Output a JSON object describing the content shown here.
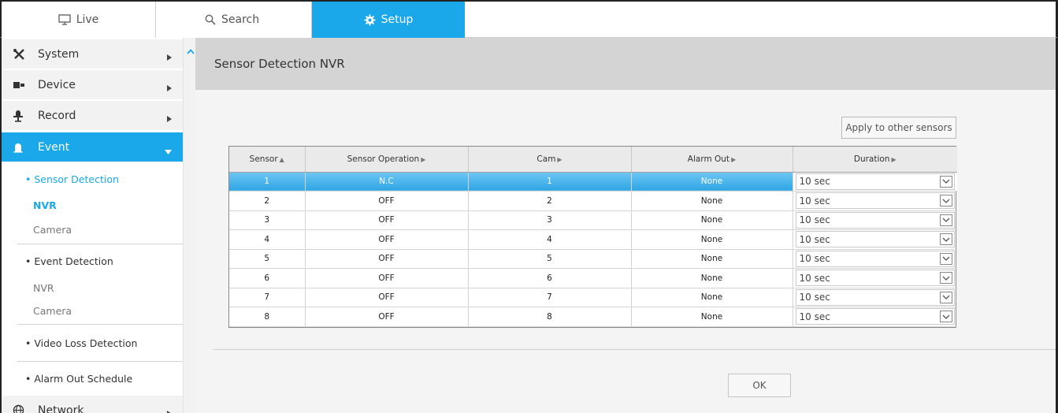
{
  "tabs": [
    {
      "label": "Live",
      "icon": "monitor-icon"
    },
    {
      "label": "Search",
      "icon": "search-icon"
    },
    {
      "label": "Setup",
      "icon": "gear-icon",
      "active": true
    }
  ],
  "sidebar": {
    "menu": [
      {
        "label": "System",
        "icon": "tools-icon"
      },
      {
        "label": "Device",
        "icon": "device-icon"
      },
      {
        "label": "Record",
        "icon": "record-icon"
      },
      {
        "label": "Event",
        "icon": "event-icon",
        "active": true
      },
      {
        "label": "Network",
        "icon": "globe-icon"
      }
    ],
    "event_sub": {
      "sensor_detection": "• Sensor Detection",
      "sensor_nvr": "NVR",
      "sensor_camera": "Camera",
      "event_detection": "• Event Detection",
      "event_nvr": "NVR",
      "event_camera": "Camera",
      "video_loss": "• Video Loss Detection",
      "alarm_out": "• Alarm Out Schedule"
    }
  },
  "main": {
    "title": "Sensor Detection NVR",
    "apply_label": "Apply to other sensors",
    "ok_label": "OK"
  },
  "table": {
    "headers": [
      "Sensor",
      "Sensor Operation",
      "Cam",
      "Alarm Out",
      "Duration"
    ],
    "rows": [
      {
        "sensor": "1",
        "operation": "N.C",
        "cam": "1",
        "alarm_out": "None",
        "duration": "10 sec"
      },
      {
        "sensor": "2",
        "operation": "OFF",
        "cam": "2",
        "alarm_out": "None",
        "duration": "10 sec"
      },
      {
        "sensor": "3",
        "operation": "OFF",
        "cam": "3",
        "alarm_out": "None",
        "duration": "10 sec"
      },
      {
        "sensor": "4",
        "operation": "OFF",
        "cam": "4",
        "alarm_out": "None",
        "duration": "10 sec"
      },
      {
        "sensor": "5",
        "operation": "OFF",
        "cam": "5",
        "alarm_out": "None",
        "duration": "10 sec"
      },
      {
        "sensor": "6",
        "operation": "OFF",
        "cam": "6",
        "alarm_out": "None",
        "duration": "10 sec"
      },
      {
        "sensor": "7",
        "operation": "OFF",
        "cam": "7",
        "alarm_out": "None",
        "duration": "10 sec"
      },
      {
        "sensor": "8",
        "operation": "OFF",
        "cam": "8",
        "alarm_out": "None",
        "duration": "10 sec"
      }
    ]
  },
  "colors": {
    "accent": "#1aa8ea",
    "title_bar": "#d4d4d4",
    "panel_bg": "#f4f4f4"
  }
}
